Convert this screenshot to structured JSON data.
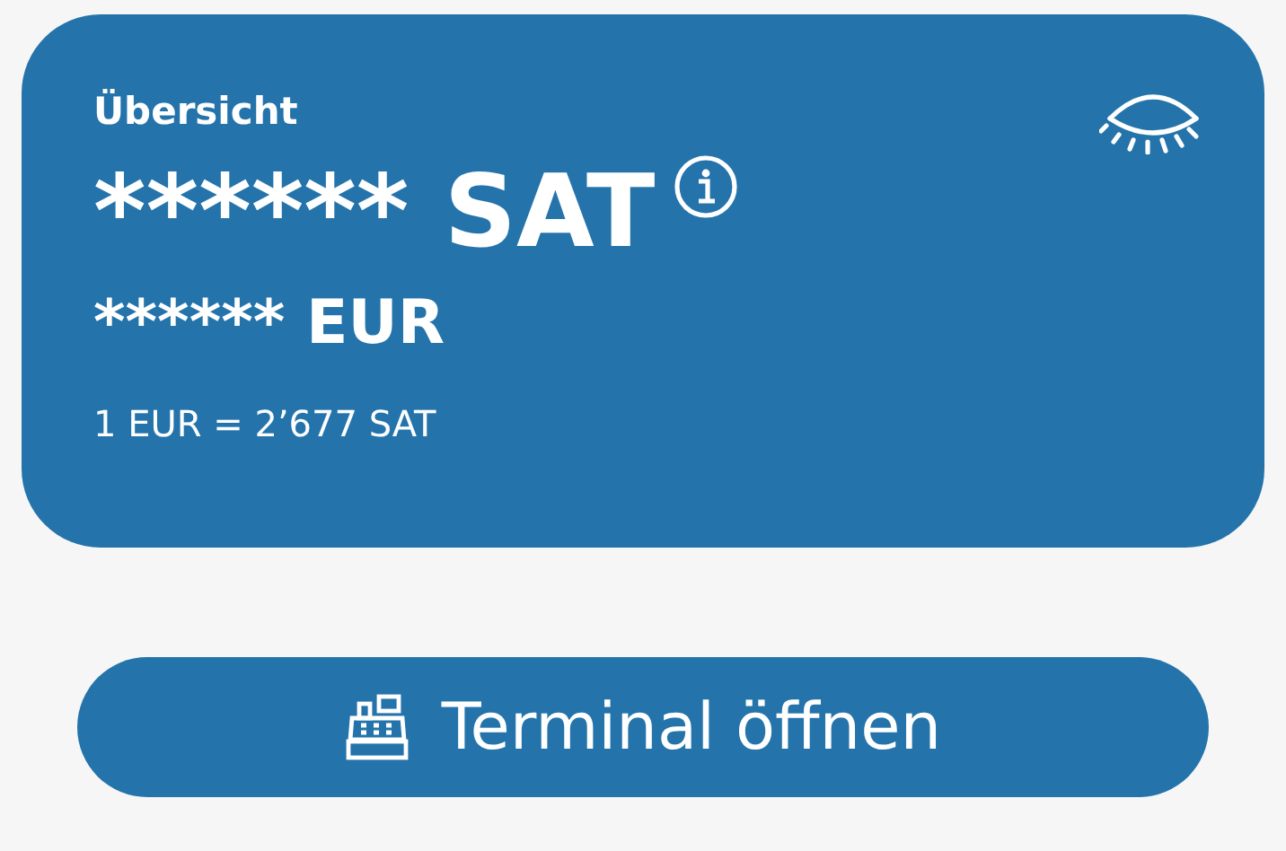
{
  "card": {
    "title": "Übersicht",
    "sat_amount": "******",
    "sat_unit": "SAT",
    "eur_amount": "******",
    "eur_unit": "EUR",
    "rate": "1 EUR = 2’677 SAT"
  },
  "terminal_button": {
    "label": "Terminal öffnen"
  }
}
